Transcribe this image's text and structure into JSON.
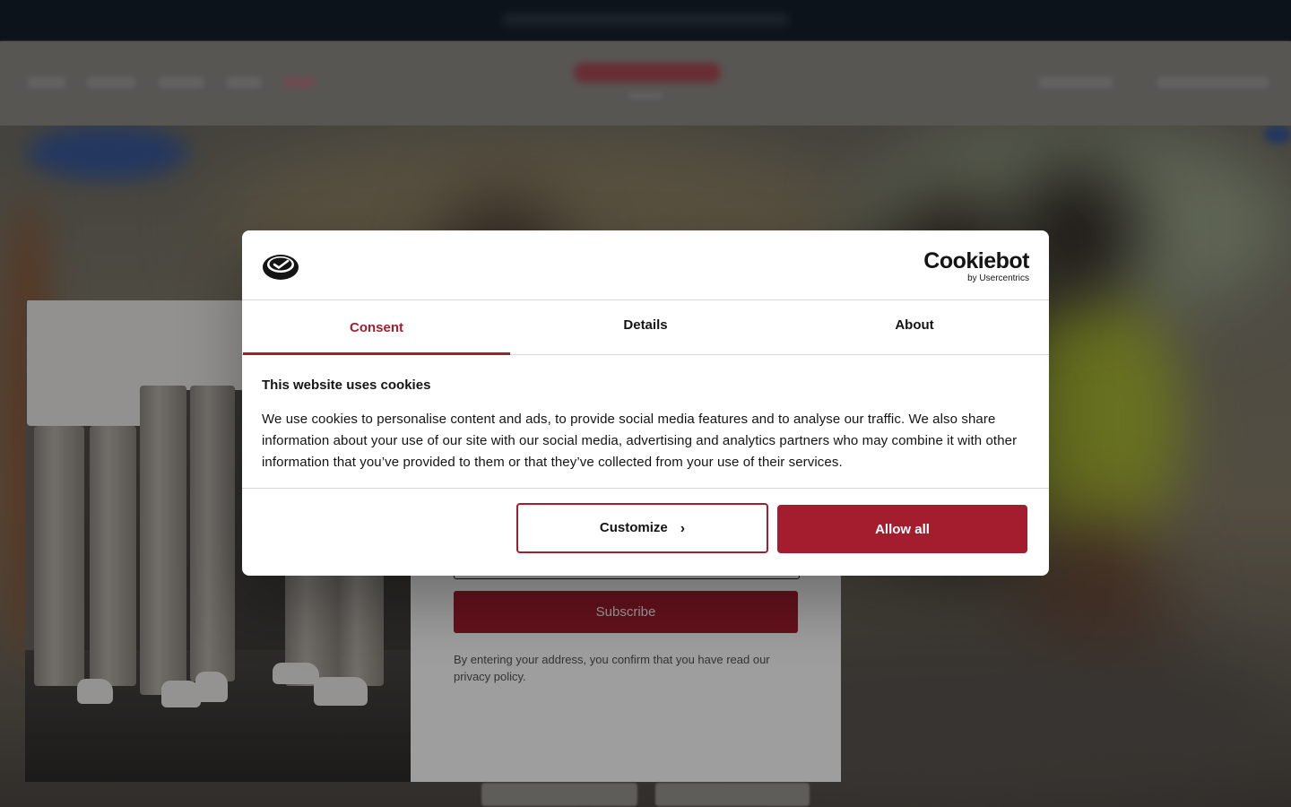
{
  "newsletter": {
    "subscribe_label": "Subscribe",
    "disclaimer": "By entering your address, you confirm that you have read our privacy policy."
  },
  "cookie_dialog": {
    "brand_name": "Cookiebot",
    "brand_sub": "by Usercentrics",
    "tabs": [
      {
        "label": "Consent",
        "active": true
      },
      {
        "label": "Details",
        "active": false
      },
      {
        "label": "About",
        "active": false
      }
    ],
    "title": "This website uses cookies",
    "body": "We use cookies to personalise content and ads, to provide social media features and to analyse our traffic. We also share information about your use of our site with our social media, advertising and analytics partners who may combine it with other information that you’ve provided to them or that they’ve collected from your use of their services.",
    "customize_label": "Customize",
    "customize_icon": "chevron-right-icon",
    "allow_label": "Allow all"
  },
  "colors": {
    "accent": "#a31d2e",
    "overlay": "rgba(0,0,0,0.38)",
    "topbar": "#16202c"
  }
}
